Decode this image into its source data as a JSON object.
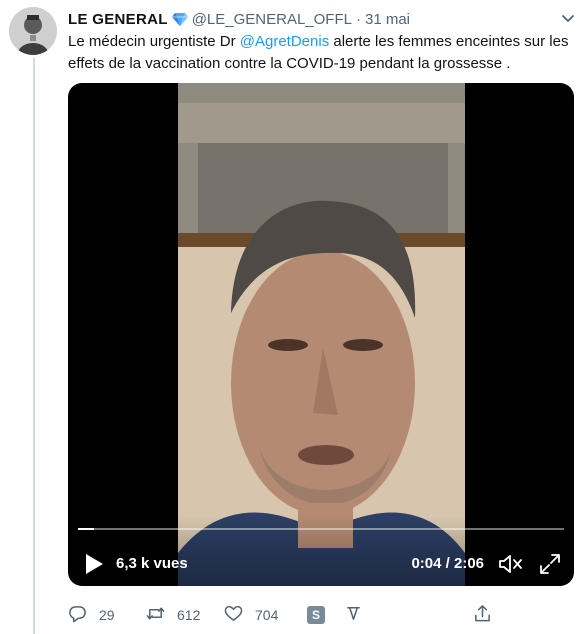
{
  "tweet": {
    "display_name": "LE GENERAL",
    "verified_icon": "blue-diamond-icon",
    "handle": "@LE_GENERAL_OFFL",
    "separator": "·",
    "date": "31 mai",
    "text_before": "Le médecin urgentiste Dr ",
    "mention": "@AgretDenis",
    "text_after": " alerte les femmes enceintes sur les effets de la vaccination contre la COVID-19 pendant la grossesse ."
  },
  "video": {
    "views": "6,3 k vues",
    "time": "0:04 / 2:06",
    "progress": 0.032,
    "icons": [
      "play-icon",
      "mute-icon",
      "fullscreen-icon"
    ]
  },
  "actions": {
    "reply_count": "29",
    "retweet_count": "612",
    "like_count": "704",
    "extension_label": "S",
    "icons": [
      "reply-icon",
      "retweet-icon",
      "like-icon",
      "s-extension-icon",
      "tip-icon",
      "share-icon"
    ]
  },
  "colors": {
    "accent": "#1d9bf0",
    "muted": "#536471",
    "text": "#0f1419"
  }
}
